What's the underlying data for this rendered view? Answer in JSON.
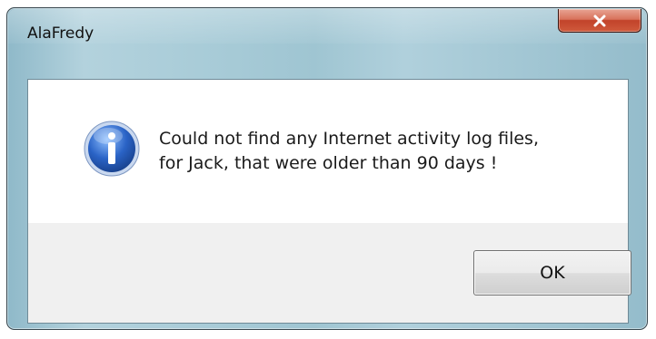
{
  "window": {
    "title": "AlaFredy",
    "close_icon": "close-icon"
  },
  "dialog": {
    "icon": "info-icon",
    "message_line1": "Could not find any Internet activity log files,",
    "message_line2": "for Jack, that were older than 90 days !",
    "ok_label": "OK"
  },
  "colors": {
    "frame": "#a9ccd8",
    "close_button": "#c2432a",
    "icon_blue": "#2a63c6"
  }
}
